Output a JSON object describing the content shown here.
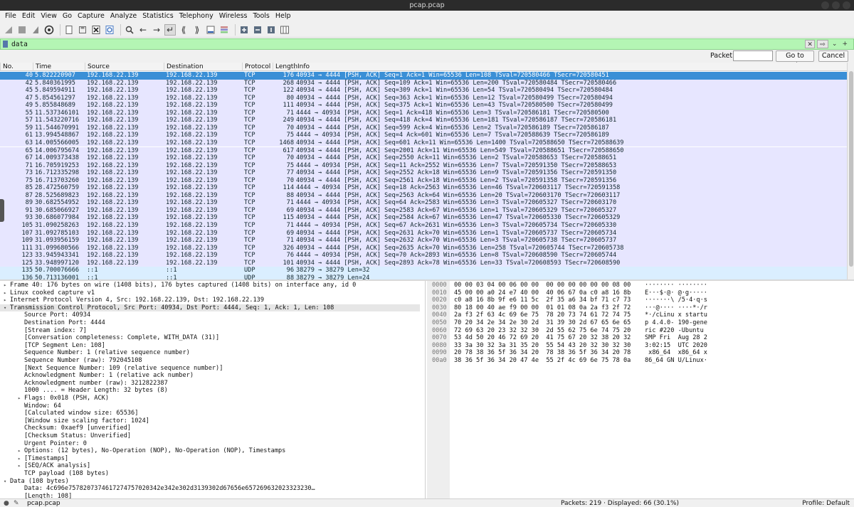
{
  "window": {
    "title": "pcap.pcap"
  },
  "menu": [
    "File",
    "Edit",
    "View",
    "Go",
    "Capture",
    "Analyze",
    "Statistics",
    "Telephony",
    "Wireless",
    "Tools",
    "Help"
  ],
  "filter": {
    "value": "data"
  },
  "goto": {
    "label": "Packet:",
    "go_button": "Go to packet",
    "cancel_button": "Cancel"
  },
  "columns": [
    "No.",
    "Time",
    "Source",
    "Destination",
    "Protocol",
    "Length",
    "Info"
  ],
  "packets": [
    {
      "no": "40",
      "time": "5.822220907",
      "src": "192.168.22.139",
      "dst": "192.168.22.139",
      "proto": "TCP",
      "len": "176",
      "info": "40934 → 4444 [PSH, ACK] Seq=1 Ack=1 Win=65536 Len=108 TSval=720580466 TSecr=720580451"
    },
    {
      "no": "42",
      "time": "5.840361995",
      "src": "192.168.22.139",
      "dst": "192.168.22.139",
      "proto": "TCP",
      "len": "268",
      "info": "40934 → 4444 [PSH, ACK] Seq=109 Ack=1 Win=65536 Len=200 TSval=720580484 TSecr=720580466"
    },
    {
      "no": "45",
      "time": "5.849594911",
      "src": "192.168.22.139",
      "dst": "192.168.22.139",
      "proto": "TCP",
      "len": "122",
      "info": "40934 → 4444 [PSH, ACK] Seq=309 Ack=1 Win=65536 Len=54 TSval=720580494 TSecr=720580484"
    },
    {
      "no": "47",
      "time": "5.854561297",
      "src": "192.168.22.139",
      "dst": "192.168.22.139",
      "proto": "TCP",
      "len": "80",
      "info": "40934 → 4444 [PSH, ACK] Seq=363 Ack=1 Win=65536 Len=12 TSval=720580499 TSecr=720580494"
    },
    {
      "no": "49",
      "time": "5.855848689",
      "src": "192.168.22.139",
      "dst": "192.168.22.139",
      "proto": "TCP",
      "len": "111",
      "info": "40934 → 4444 [PSH, ACK] Seq=375 Ack=1 Win=65536 Len=43 TSval=720580500 TSecr=720580499"
    },
    {
      "no": "55",
      "time": "11.537346101",
      "src": "192.168.22.139",
      "dst": "192.168.22.139",
      "proto": "TCP",
      "len": "71",
      "info": "4444 → 40934 [PSH, ACK] Seq=1 Ack=418 Win=65536 Len=3 TSval=720586181 TSecr=720580500"
    },
    {
      "no": "57",
      "time": "11.543220716",
      "src": "192.168.22.139",
      "dst": "192.168.22.139",
      "proto": "TCP",
      "len": "249",
      "info": "40934 → 4444 [PSH, ACK] Seq=418 Ack=4 Win=65536 Len=181 TSval=720586187 TSecr=720586181"
    },
    {
      "no": "59",
      "time": "11.544670991",
      "src": "192.168.22.139",
      "dst": "192.168.22.139",
      "proto": "TCP",
      "len": "70",
      "info": "40934 → 4444 [PSH, ACK] Seq=599 Ack=4 Win=65536 Len=2 TSval=720586189 TSecr=720586187"
    },
    {
      "no": "61",
      "time": "13.994548867",
      "src": "192.168.22.139",
      "dst": "192.168.22.139",
      "proto": "TCP",
      "len": "75",
      "info": "4444 → 40934 [PSH, ACK] Seq=4 Ack=601 Win=65536 Len=7 TSval=720588639 TSecr=720586189"
    },
    {
      "no": "63",
      "time": "14.005566005",
      "src": "192.168.22.139",
      "dst": "192.168.22.139",
      "proto": "TCP",
      "len": "1468",
      "info": "40934 → 4444 [PSH, ACK] Seq=601 Ack=11 Win=65536 Len=1400 TSval=720588650 TSecr=720588639"
    },
    {
      "no": "65",
      "time": "14.006795674",
      "src": "192.168.22.139",
      "dst": "192.168.22.139",
      "proto": "TCP",
      "len": "617",
      "info": "40934 → 4444 [PSH, ACK] Seq=2001 Ack=11 Win=65536 Len=549 TSval=720588651 TSecr=720588650"
    },
    {
      "no": "67",
      "time": "14.009373438",
      "src": "192.168.22.139",
      "dst": "192.168.22.139",
      "proto": "TCP",
      "len": "70",
      "info": "40934 → 4444 [PSH, ACK] Seq=2550 Ack=11 Win=65536 Len=2 TSval=720588653 TSecr=720588651"
    },
    {
      "no": "71",
      "time": "16.705919253",
      "src": "192.168.22.139",
      "dst": "192.168.22.139",
      "proto": "TCP",
      "len": "75",
      "info": "4444 → 40934 [PSH, ACK] Seq=11 Ack=2552 Win=65536 Len=7 TSval=720591350 TSecr=720588653"
    },
    {
      "no": "73",
      "time": "16.712335298",
      "src": "192.168.22.139",
      "dst": "192.168.22.139",
      "proto": "TCP",
      "len": "77",
      "info": "40934 → 4444 [PSH, ACK] Seq=2552 Ack=18 Win=65536 Len=9 TSval=720591356 TSecr=720591350"
    },
    {
      "no": "75",
      "time": "16.713703260",
      "src": "192.168.22.139",
      "dst": "192.168.22.139",
      "proto": "TCP",
      "len": "70",
      "info": "40934 → 4444 [PSH, ACK] Seq=2561 Ack=18 Win=65536 Len=2 TSval=720591358 TSecr=720591356"
    },
    {
      "no": "85",
      "time": "28.472560759",
      "src": "192.168.22.139",
      "dst": "192.168.22.139",
      "proto": "TCP",
      "len": "114",
      "info": "4444 → 40934 [PSH, ACK] Seq=18 Ack=2563 Win=65536 Len=46 TSval=720603117 TSecr=720591358"
    },
    {
      "no": "87",
      "time": "28.525689823",
      "src": "192.168.22.139",
      "dst": "192.168.22.139",
      "proto": "TCP",
      "len": "88",
      "info": "40934 → 4444 [PSH, ACK] Seq=2563 Ack=64 Win=65536 Len=20 TSval=720603170 TSecr=720603117"
    },
    {
      "no": "89",
      "time": "30.682554952",
      "src": "192.168.22.139",
      "dst": "192.168.22.139",
      "proto": "TCP",
      "len": "71",
      "info": "4444 → 40934 [PSH, ACK] Seq=64 Ack=2583 Win=65536 Len=3 TSval=720605327 TSecr=720603170"
    },
    {
      "no": "91",
      "time": "30.685066927",
      "src": "192.168.22.139",
      "dst": "192.168.22.139",
      "proto": "TCP",
      "len": "69",
      "info": "40934 → 4444 [PSH, ACK] Seq=2583 Ack=67 Win=65536 Len=1 TSval=720605329 TSecr=720605327"
    },
    {
      "no": "93",
      "time": "30.686077984",
      "src": "192.168.22.139",
      "dst": "192.168.22.139",
      "proto": "TCP",
      "len": "115",
      "info": "40934 → 4444 [PSH, ACK] Seq=2584 Ack=67 Win=65536 Len=47 TSval=720605330 TSecr=720605329"
    },
    {
      "no": "105",
      "time": "31.090258263",
      "src": "192.168.22.139",
      "dst": "192.168.22.139",
      "proto": "TCP",
      "len": "71",
      "info": "4444 → 40934 [PSH, ACK] Seq=67 Ack=2631 Win=65536 Len=3 TSval=720605734 TSecr=720605330"
    },
    {
      "no": "107",
      "time": "31.092785103",
      "src": "192.168.22.139",
      "dst": "192.168.22.139",
      "proto": "TCP",
      "len": "69",
      "info": "40934 → 4444 [PSH, ACK] Seq=2631 Ack=70 Win=65536 Len=1 TSval=720605737 TSecr=720605734"
    },
    {
      "no": "109",
      "time": "31.093956159",
      "src": "192.168.22.139",
      "dst": "192.168.22.139",
      "proto": "TCP",
      "len": "71",
      "info": "40934 → 4444 [PSH, ACK] Seq=2632 Ack=70 Win=65536 Len=3 TSval=720605738 TSecr=720605737"
    },
    {
      "no": "111",
      "time": "31.099680566",
      "src": "192.168.22.139",
      "dst": "192.168.22.139",
      "proto": "TCP",
      "len": "326",
      "info": "40934 → 4444 [PSH, ACK] Seq=2635 Ack=70 Win=65536 Len=258 TSval=720605744 TSecr=720605738"
    },
    {
      "no": "123",
      "time": "33.945943341",
      "src": "192.168.22.139",
      "dst": "192.168.22.139",
      "proto": "TCP",
      "len": "76",
      "info": "4444 → 40934 [PSH, ACK] Seq=70 Ack=2893 Win=65536 Len=8 TSval=720608590 TSecr=720605744"
    },
    {
      "no": "125",
      "time": "33.948997120",
      "src": "192.168.22.139",
      "dst": "192.168.22.139",
      "proto": "TCP",
      "len": "101",
      "info": "40934 → 4444 [PSH, ACK] Seq=2893 Ack=78 Win=65536 Len=33 TSval=720608593 TSecr=720608590"
    },
    {
      "no": "135",
      "time": "50.700076666",
      "src": "::1",
      "dst": "::1",
      "proto": "UDP",
      "len": "96",
      "info": "38279 → 38279 Len=32"
    },
    {
      "no": "136",
      "time": "50.713136001",
      "src": "::1",
      "dst": "::1",
      "proto": "UDP",
      "len": "88",
      "info": "38279 → 38279 Len=24"
    }
  ],
  "details": [
    {
      "text": "Frame 40: 176 bytes on wire (1408 bits), 176 bytes captured (1408 bits) on interface any, id 0",
      "arrow": "right",
      "indent": 0
    },
    {
      "text": "Linux cooked capture v1",
      "arrow": "right",
      "indent": 0
    },
    {
      "text": "Internet Protocol Version 4, Src: 192.168.22.139, Dst: 192.168.22.139",
      "arrow": "right",
      "indent": 0
    },
    {
      "text": "Transmission Control Protocol, Src Port: 40934, Dst Port: 4444, Seq: 1, Ack: 1, Len: 108",
      "arrow": "down",
      "indent": 0,
      "hl": true
    },
    {
      "text": "Source Port: 40934",
      "arrow": "",
      "indent": 1
    },
    {
      "text": "Destination Port: 4444",
      "arrow": "",
      "indent": 1
    },
    {
      "text": "[Stream index: 7]",
      "arrow": "",
      "indent": 1
    },
    {
      "text": "[Conversation completeness: Complete, WITH_DATA (31)]",
      "arrow": "",
      "indent": 1
    },
    {
      "text": "[TCP Segment Len: 108]",
      "arrow": "",
      "indent": 1
    },
    {
      "text": "Sequence Number: 1    (relative sequence number)",
      "arrow": "",
      "indent": 1
    },
    {
      "text": "Sequence Number (raw): 792045108",
      "arrow": "",
      "indent": 1
    },
    {
      "text": "[Next Sequence Number: 109    (relative sequence number)]",
      "arrow": "",
      "indent": 1
    },
    {
      "text": "Acknowledgment Number: 1    (relative ack number)",
      "arrow": "",
      "indent": 1
    },
    {
      "text": "Acknowledgment number (raw): 3212822387",
      "arrow": "",
      "indent": 1
    },
    {
      "text": "1000 .... = Header Length: 32 bytes (8)",
      "arrow": "",
      "indent": 1
    },
    {
      "text": "Flags: 0x018 (PSH, ACK)",
      "arrow": "right",
      "indent": 1
    },
    {
      "text": "Window: 64",
      "arrow": "",
      "indent": 1
    },
    {
      "text": "[Calculated window size: 65536]",
      "arrow": "",
      "indent": 1
    },
    {
      "text": "[Window size scaling factor: 1024]",
      "arrow": "",
      "indent": 1
    },
    {
      "text": "Checksum: 0xaef9 [unverified]",
      "arrow": "",
      "indent": 1
    },
    {
      "text": "[Checksum Status: Unverified]",
      "arrow": "",
      "indent": 1
    },
    {
      "text": "Urgent Pointer: 0",
      "arrow": "",
      "indent": 1
    },
    {
      "text": "Options: (12 bytes), No-Operation (NOP), No-Operation (NOP), Timestamps",
      "arrow": "right",
      "indent": 1
    },
    {
      "text": "[Timestamps]",
      "arrow": "right",
      "indent": 1
    },
    {
      "text": "[SEQ/ACK analysis]",
      "arrow": "right",
      "indent": 1
    },
    {
      "text": "TCP payload (108 bytes)",
      "arrow": "",
      "indent": 1
    },
    {
      "text": "Data (108 bytes)",
      "arrow": "down",
      "indent": 0
    },
    {
      "text": "Data: 4c696e7578207374617274757020342e342e302d3139302d67656e657269632023323230…",
      "arrow": "",
      "indent": 1
    },
    {
      "text": "[Length: 108]",
      "arrow": "",
      "indent": 1
    }
  ],
  "hex": [
    {
      "off": "0000",
      "bytes": "00 00 03 04 00 06 00 00  00 00 00 00 00 00 08 00",
      "ascii": "········ ········"
    },
    {
      "off": "0010",
      "bytes": "45 00 00 a0 24 e7 40 00  40 06 67 0a c0 a8 16 8b",
      "ascii": "E···$·@· @·g·····"
    },
    {
      "off": "0020",
      "bytes": "c0 a8 16 8b 9f e6 11 5c  2f 35 a6 34 bf 71 c7 73",
      "ascii": "·······\\ /5·4·q·s"
    },
    {
      "off": "0030",
      "bytes": "80 18 00 40 ae f9 00 00  01 01 08 0a 2a f3 2f 72",
      "ascii": "···@···· ····*·/r"
    },
    {
      "off": "0040",
      "bytes": "2a f3 2f 63 4c 69 6e 75  78 20 73 74 61 72 74 75",
      "ascii": "*·/cLinu x startu"
    },
    {
      "off": "0050",
      "bytes": "70 20 34 2e 34 2e 30 2d  31 39 30 2d 67 65 6e 65",
      "ascii": "p 4.4.0- 190-gene"
    },
    {
      "off": "0060",
      "bytes": "72 69 63 20 23 32 32 30  2d 55 62 75 6e 74 75 20",
      "ascii": "ric #220 -Ubuntu "
    },
    {
      "off": "0070",
      "bytes": "53 4d 50 20 46 72 69 20  41 75 67 20 32 38 20 32",
      "ascii": "SMP Fri  Aug 28 2"
    },
    {
      "off": "0080",
      "bytes": "33 3a 30 32 3a 31 35 20  55 54 43 20 32 30 32 30",
      "ascii": "3:02:15  UTC 2020"
    },
    {
      "off": "0090",
      "bytes": "20 78 38 36 5f 36 34 20  78 38 36 5f 36 34 20 78",
      "ascii": " x86_64  x86_64 x"
    },
    {
      "off": "00a0",
      "bytes": "38 36 5f 36 34 20 47 4e  55 2f 4c 69 6e 75 78 0a",
      "ascii": "86_64 GN U/Linux·"
    }
  ],
  "status": {
    "file": "pcap.pcap",
    "packets": "Packets: 219 · Displayed: 66 (30.1%)",
    "profile": "Profile: Default"
  },
  "colors": {
    "selected": "#3a8fd6",
    "tcp": "#e7e6ff",
    "udp": "#daeeff",
    "filter_ok": "#b4f5b4"
  }
}
